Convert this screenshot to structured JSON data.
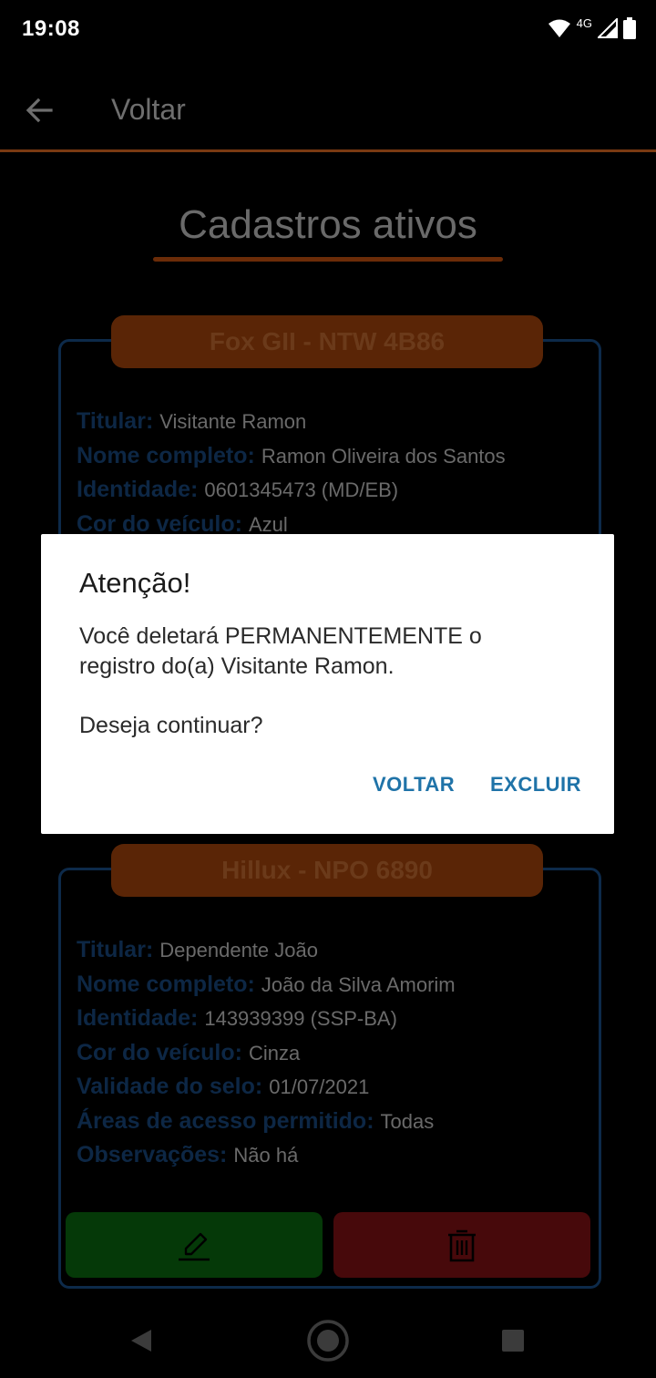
{
  "status_bar": {
    "time": "19:08",
    "network": "4G"
  },
  "app_bar": {
    "back_icon": "arrow-back-icon",
    "title": "Voltar"
  },
  "page": {
    "title": "Cadastros ativos"
  },
  "cards": [
    {
      "header": "Fox GII - NTW 4B86",
      "fields": [
        {
          "label": "Titular:",
          "value": "Visitante Ramon"
        },
        {
          "label": "Nome completo:",
          "value": "Ramon Oliveira dos Santos"
        },
        {
          "label": "Identidade:",
          "value": "0601345473 (MD/EB)"
        },
        {
          "label": "Cor do veículo:",
          "value": "Azul"
        }
      ]
    },
    {
      "header": "Hillux - NPO 6890",
      "fields": [
        {
          "label": "Titular:",
          "value": "Dependente João"
        },
        {
          "label": "Nome completo:",
          "value": "João da Silva Amorim"
        },
        {
          "label": "Identidade:",
          "value": "143939399 (SSP-BA)"
        },
        {
          "label": "Cor do veículo:",
          "value": "Cinza"
        },
        {
          "label": "Validade do selo:",
          "value": "01/07/2021"
        },
        {
          "label": "Áreas de acesso permitido:",
          "value": "Todas"
        },
        {
          "label": "Observações:",
          "value": "Não há"
        }
      ],
      "actions": {
        "edit_icon": "pencil-icon",
        "delete_icon": "trash-icon"
      }
    }
  ],
  "dialog": {
    "title": "Atenção!",
    "message": "Você deletará PERMANENTEMENTE o registro do(a) Visitante Ramon.",
    "question": "Deseja continuar?",
    "cancel_label": "VOLTAR",
    "confirm_label": "EXCLUIR"
  },
  "colors": {
    "accent_orange": "#5a2506",
    "label_blue": "#0d2745",
    "dialog_button": "#1f73a8",
    "edit_green": "#053908",
    "delete_red": "#47090b"
  }
}
